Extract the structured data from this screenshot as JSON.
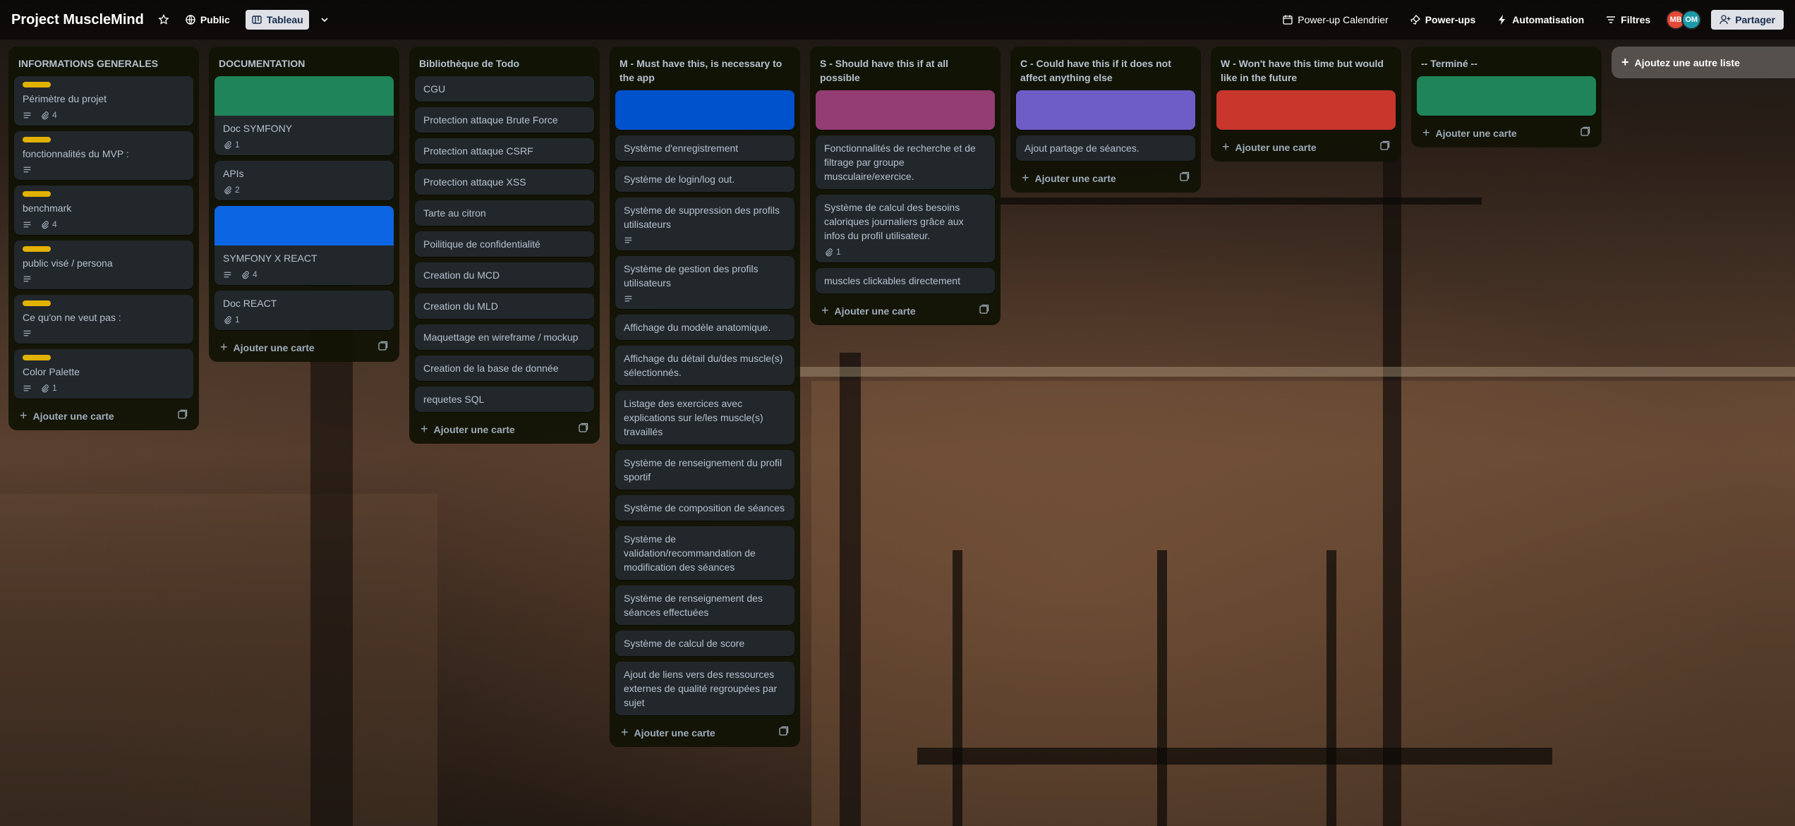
{
  "header": {
    "title": "Project MuscleMind",
    "visibility": "Public",
    "view": "Tableau",
    "powerup_calendar": "Power-up Calendrier",
    "powerups": "Power-ups",
    "automation": "Automatisation",
    "filters": "Filtres",
    "share": "Partager",
    "avatars": [
      {
        "initials": "MB",
        "color": "#e34935"
      },
      {
        "initials": "OM",
        "color": "#1d9aaa"
      }
    ]
  },
  "lists": [
    {
      "title": "INFORMATIONS GENERALES",
      "cards": [
        {
          "label": true,
          "title": "Périmètre du projet",
          "desc": true,
          "attach": "4"
        },
        {
          "label": true,
          "title": "fonctionnalités du MVP :",
          "desc": true,
          "attach": ""
        },
        {
          "label": true,
          "title": "benchmark",
          "desc": true,
          "attach": "4"
        },
        {
          "label": true,
          "title": "public visé / persona",
          "desc": true,
          "attach": ""
        },
        {
          "label": true,
          "title": "Ce qu'on ne veut pas :",
          "desc": true,
          "attach": ""
        },
        {
          "label": true,
          "title": "Color Palette",
          "desc": true,
          "attach": "1"
        }
      ],
      "add": "Ajouter une carte"
    },
    {
      "title": "DOCUMENTATION",
      "cards": [
        {
          "cover": "#1f845a",
          "title": "Doc SYMFONY",
          "attach": "1"
        },
        {
          "title": "APIs",
          "attach": "2"
        },
        {
          "cover": "#0c66e4",
          "title": "SYMFONY X REACT",
          "desc": true,
          "attach": "4"
        },
        {
          "title": "Doc REACT",
          "attach": "1"
        }
      ],
      "add": "Ajouter une carte"
    },
    {
      "title": "Bibliothèque de Todo",
      "cards": [
        {
          "title": "CGU"
        },
        {
          "title": "Protection attaque Brute Force"
        },
        {
          "title": "Protection attaque CSRF"
        },
        {
          "title": "Protection attaque XSS"
        },
        {
          "title": "Tarte au citron"
        },
        {
          "title": "Poilitique de confidentialité"
        },
        {
          "title": "Creation du MCD"
        },
        {
          "title": "Creation du MLD"
        },
        {
          "title": "Maquettage en wireframe / mockup"
        },
        {
          "title": "Creation de la base de donnée"
        },
        {
          "title": "requetes SQL"
        }
      ],
      "add": "Ajouter une carte"
    },
    {
      "title": "M - Must have this, is necessary to the app",
      "cards": [
        {
          "cover": "#0052cc",
          "title": ""
        },
        {
          "title": "Système d'enregistrement"
        },
        {
          "title": "Système de login/log out."
        },
        {
          "title": "Système de suppression des profils utilisateurs",
          "desc": true
        },
        {
          "title": "Système de gestion des profils utilisateurs",
          "desc": true
        },
        {
          "title": "Affichage du modèle anatomique."
        },
        {
          "title": "Affichage du détail du/des muscle(s) sélectionnés."
        },
        {
          "title": "Listage des exercices avec explications sur le/les muscle(s) travaillés"
        },
        {
          "title": "Système de renseignement du profil sportif"
        },
        {
          "title": "Système de composition de séances"
        },
        {
          "title": "Système de validation/recommandation de modification des séances"
        },
        {
          "title": "Système de renseignement des séances effectuées"
        },
        {
          "title": "Système de calcul de score"
        },
        {
          "title": "Ajout de liens vers des ressources externes de qualité regroupées par sujet"
        }
      ],
      "add": "Ajouter une carte"
    },
    {
      "title": "S - Should have this if at all possible",
      "cards": [
        {
          "cover": "#943d73",
          "title": ""
        },
        {
          "title": "Fonctionnalités de recherche et de filtrage par groupe musculaire/exercice."
        },
        {
          "title": "Système de calcul des besoins caloriques journaliers grâce aux infos du profil utilisateur.",
          "attach": "1"
        },
        {
          "title": "muscles clickables directement"
        }
      ],
      "add": "Ajouter une carte"
    },
    {
      "title": "C - Could have this if it does not affect anything else",
      "cards": [
        {
          "cover": "#6e5dc6",
          "title": ""
        },
        {
          "title": "Ajout partage de séances."
        }
      ],
      "add": "Ajouter une carte"
    },
    {
      "title": "W - Won't have this time but would like in the future",
      "cards": [
        {
          "cover": "#c9372c",
          "title": ""
        }
      ],
      "add": "Ajouter une carte"
    },
    {
      "title": "-- Terminé --",
      "cards": [
        {
          "cover": "#1f845a",
          "title": ""
        }
      ],
      "add": "Ajouter une carte"
    }
  ],
  "add_list": "Ajoutez une autre liste"
}
